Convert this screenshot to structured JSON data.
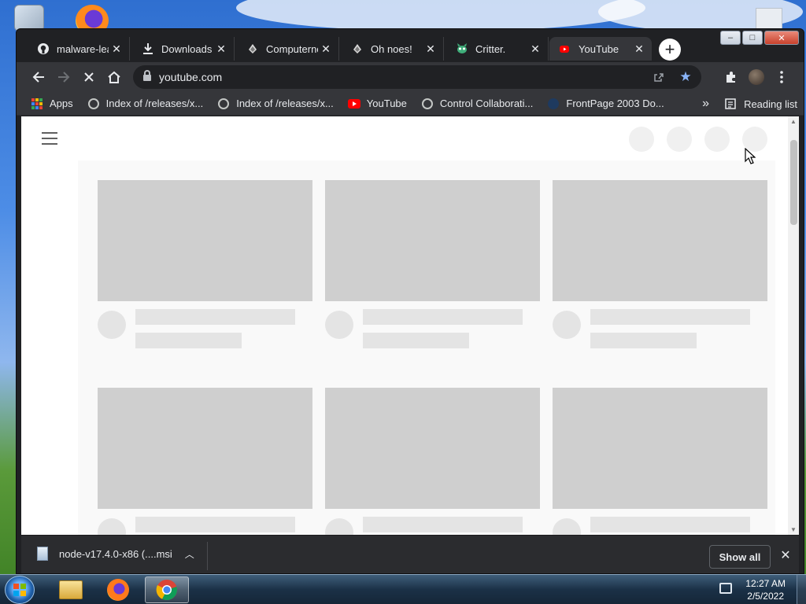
{
  "browser": {
    "tabs": [
      {
        "title": "malware-leak",
        "icon": "github-icon",
        "active": false
      },
      {
        "title": "Downloads",
        "icon": "download-icon",
        "active": false
      },
      {
        "title": "Computernewb",
        "icon": "computernewb-icon",
        "active": false
      },
      {
        "title": "Oh noes!",
        "icon": "computernewb-icon",
        "active": false
      },
      {
        "title": "Critter.",
        "icon": "critter-icon",
        "active": false
      },
      {
        "title": "YouTube",
        "icon": "youtube-icon",
        "active": true
      }
    ],
    "new_tab_label": "+",
    "close_glyph": "✕",
    "address": "youtube.com",
    "bookmarks": [
      {
        "label": "Apps",
        "icon": "apps-grid-icon"
      },
      {
        "label": "Index of /releases/x...",
        "icon": "globe-icon"
      },
      {
        "label": "Index of /releases/x...",
        "icon": "globe-icon"
      },
      {
        "label": "YouTube",
        "icon": "youtube-icon"
      },
      {
        "label": "Control Collaborati...",
        "icon": "globe-icon"
      },
      {
        "label": "FrontPage 2003 Do...",
        "icon": "globe-icon"
      }
    ],
    "bookmarks_overflow": "»",
    "reading_list": "Reading list"
  },
  "download_bar": {
    "filename": "node-v17.4.0-x86 (....msi",
    "show_all": "Show all"
  },
  "taskbar": {
    "time": "12:27 AM",
    "date": "2/5/2022"
  }
}
